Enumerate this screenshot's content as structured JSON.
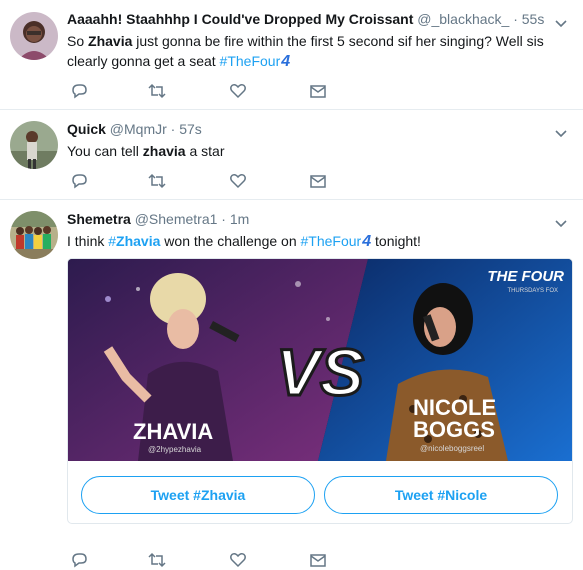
{
  "tweets": [
    {
      "name": "Aaaahh! Staahhhp I Could've Dropped My Croissant",
      "handle": "@_blackhack_",
      "time": "55s",
      "text": {
        "t1": "So ",
        "b1": "Zhavia",
        "t2": " just gonna be fire within the first 5 second sif her singing? Well sis clearly gonna get a seat ",
        "tag": "#TheFour",
        "emoji": "4"
      }
    },
    {
      "name": "Quick",
      "handle": "@MqmJr",
      "time": "57s",
      "text": {
        "t1": "You can tell ",
        "b1": "zhavia",
        "t2": " a star"
      }
    },
    {
      "name": "Shemetra",
      "handle": "@Shemetra1",
      "time": "1m",
      "text": {
        "t1": "I think ",
        "tag1": "#",
        "tag1b": "Zhavia",
        "t2": " won the challenge on ",
        "tag2": "#TheFour",
        "emoji": "4",
        "t3": " tonight!"
      },
      "card": {
        "vs": "VS",
        "left_name": "ZHAVIA",
        "left_handle": "@2hypezhavia",
        "right_name_1": "NICOLE",
        "right_name_2": "BOGGS",
        "right_handle": "@nicoleboggsreel",
        "logo": "THE FOUR",
        "logo_sub": "THURSDAYS FOX",
        "btn_left": "Tweet #Zhavia",
        "btn_right": "Tweet #Nicole"
      }
    }
  ],
  "icons": [
    "reply-icon",
    "retweet-icon",
    "like-icon",
    "direct-message-icon",
    "caret-down-icon"
  ],
  "colors": {
    "link": "#1da1f2",
    "icon": "#657786",
    "border": "#e6ecf0"
  }
}
